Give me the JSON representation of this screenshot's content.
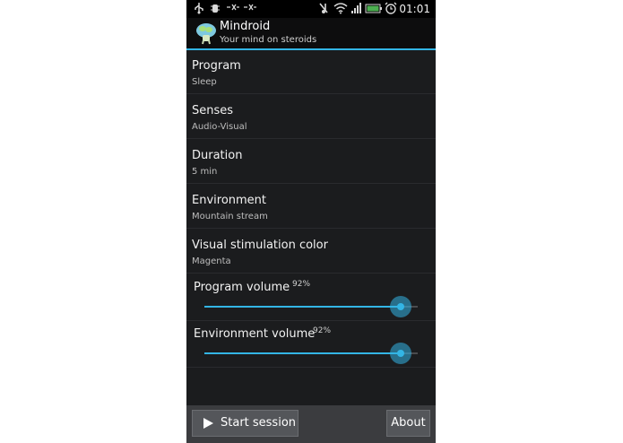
{
  "status_bar": {
    "time": "01:01",
    "left_icons": [
      "usb-icon",
      "debug-icon",
      "notification-icon",
      "notification-icon"
    ],
    "right_icons": [
      "mute-icon",
      "wifi-icon",
      "signal-icon",
      "battery-icon",
      "alarm-icon"
    ]
  },
  "action_bar": {
    "title": "Mindroid",
    "subtitle": "Your mind on steroids"
  },
  "preferences": [
    {
      "title": "Program",
      "summary": "Sleep"
    },
    {
      "title": "Senses",
      "summary": "Audio-Visual"
    },
    {
      "title": "Duration",
      "summary": "5 min"
    },
    {
      "title": "Environment",
      "summary": "Mountain stream"
    },
    {
      "title": "Visual stimulation color",
      "summary": "Magenta"
    }
  ],
  "sliders": [
    {
      "title": "Program volume",
      "value_label": "92%",
      "value": 92
    },
    {
      "title": "Environment volume",
      "value_label": "92%",
      "value": 92
    }
  ],
  "buttons": {
    "start_label": "Start session",
    "about_label": "About"
  },
  "colors": {
    "accent": "#33b5e5",
    "background": "#1b1c1e",
    "button_bar": "#3b3c3f"
  }
}
